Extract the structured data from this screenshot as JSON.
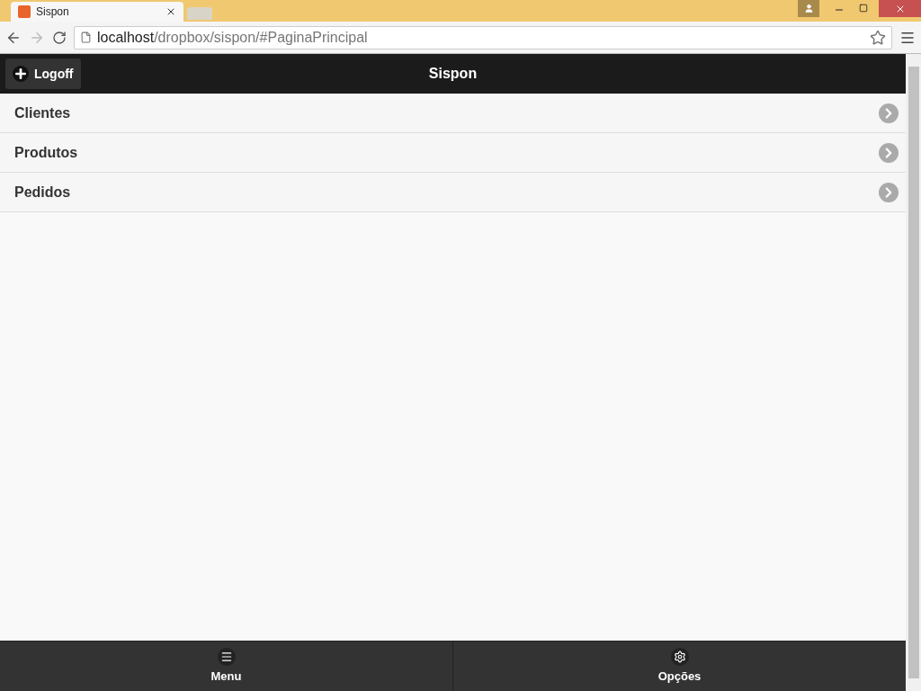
{
  "browser": {
    "tab_title": "Sispon",
    "url_host": "localhost",
    "url_path": "/dropbox/sispon/#PaginaPrincipal"
  },
  "header": {
    "title": "Sispon",
    "button": "Logoff"
  },
  "list": [
    {
      "label": "Clientes"
    },
    {
      "label": "Produtos"
    },
    {
      "label": "Pedidos"
    }
  ],
  "footer": [
    {
      "label": "Menu",
      "kind": "menu"
    },
    {
      "label": "Opções",
      "kind": "gear"
    }
  ]
}
